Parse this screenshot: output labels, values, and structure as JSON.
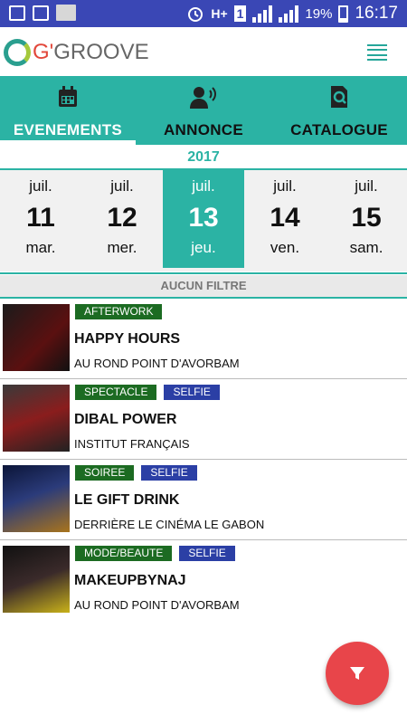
{
  "status_bar": {
    "time": "16:17",
    "battery": "19%",
    "network": "H+",
    "sim": "1"
  },
  "app": {
    "logo_prefix": "G'",
    "logo_text": "GROOVE"
  },
  "tabs": [
    {
      "label": "EVENEMENTS",
      "icon": "calendar-icon",
      "active": true
    },
    {
      "label": "ANNONCE",
      "icon": "megaphone-icon"
    },
    {
      "label": "CATALOGUE",
      "icon": "catalog-search-icon"
    }
  ],
  "year": "2017",
  "days": [
    {
      "month": "juil.",
      "day": "11",
      "weekday": "mar."
    },
    {
      "month": "juil.",
      "day": "12",
      "weekday": "mer."
    },
    {
      "month": "juil.",
      "day": "13",
      "weekday": "jeu.",
      "selected": true
    },
    {
      "month": "juil.",
      "day": "14",
      "weekday": "ven."
    },
    {
      "month": "juil.",
      "day": "15",
      "weekday": "sam."
    }
  ],
  "filter_label": "AUCUN FILTRE",
  "events": [
    {
      "category": "AFTERWORK",
      "badge": "",
      "title": "HAPPY HOURS",
      "place": "AU ROND POINT D'AVORBAM"
    },
    {
      "category": "SPECTACLE",
      "badge": "SELFIE",
      "title": "DIBAL POWER",
      "place": "INSTITUT FRANÇAIS"
    },
    {
      "category": "SOIREE",
      "badge": "SELFIE",
      "title": "LE GIFT DRINK",
      "place": "DERRIÈRE LE CINÉMA LE GABON"
    },
    {
      "category": "MODE/BEAUTE",
      "badge": "SELFIE",
      "title": "MAKEUPBYNAJ",
      "place": "AU ROND POINT D'AVORBAM"
    }
  ],
  "colors": {
    "accent": "#2bb3a4",
    "category_tag": "#1c6b22",
    "selfie_tag": "#2b3fa5",
    "fab": "#e8454a",
    "status_bar": "#3a47b5"
  }
}
